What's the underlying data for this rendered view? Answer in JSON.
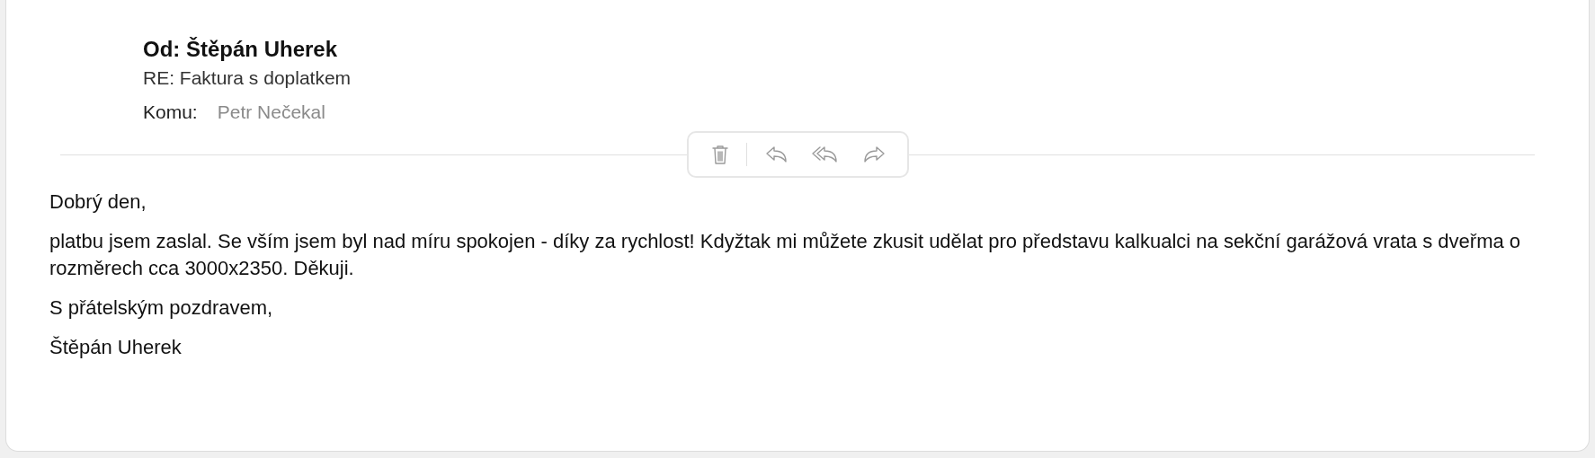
{
  "message": {
    "from": "Od: Štěpán Uherek",
    "subject": "RE: Faktura s doplatkem",
    "to_label": "Komu:",
    "to": "Petr Nečekal"
  },
  "toolbar": [
    {
      "kind": "delete"
    },
    {
      "kind": "reply"
    },
    {
      "kind": "reply-all"
    },
    {
      "kind": "forward"
    }
  ],
  "body": [
    "Dobrý den,",
    "platbu jsem zaslal. Se vším jsem byl nad míru spokojen - díky za rychlost! Kdyžtak mi můžete zkusit udělat pro představu kalkualci na sekční garážová vrata s dveřma o rozměrech cca 3000x2350. Děkuji.",
    "S přátelským pozdravem,",
    "Štěpán Uherek"
  ]
}
